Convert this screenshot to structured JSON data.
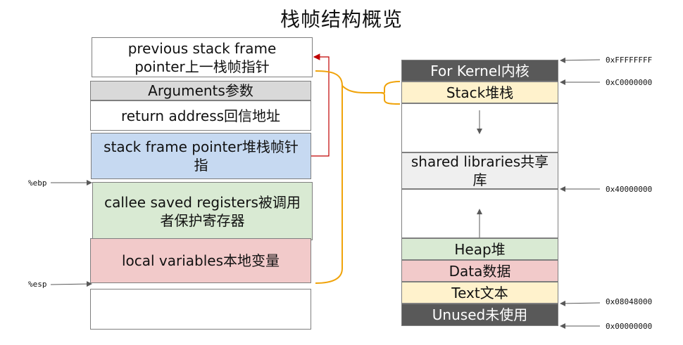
{
  "title": "栈帧结构概览",
  "left_stack": {
    "previous_frame": "previous stack frame pointer上一栈帧指针",
    "arguments": "Arguments参数",
    "return_address": "return address回信地址",
    "stack_frame_pointer": "stack frame pointer堆栈帧针指",
    "callee_saved": "callee saved registers被调用者保护寄存器",
    "local_variables": "local variables本地变量",
    "empty": ""
  },
  "registers": {
    "ebp": "%ebp",
    "esp": "%esp"
  },
  "memory_map": {
    "kernel": "For Kernel内核",
    "stack": "Stack堆栈",
    "shared_libs": "shared libraries共享库",
    "heap": "Heap堆",
    "data": "Data数据",
    "text": "Text文本",
    "unused": "Unused未使用"
  },
  "addresses": {
    "a_ffffffff": "0xFFFFFFFF",
    "a_c0000000": "0xC0000000",
    "a_40000000": "0x40000000",
    "a_08048000": "0x08048000",
    "a_00000000": "0x00000000"
  },
  "colors": {
    "arguments_bg": "#d9d9d9",
    "frame_pointer_bg": "#c6d9f1",
    "callee_bg": "#d9ead3",
    "locals_bg": "#f2caca",
    "kernel_bg": "#595959",
    "stack_bg": "#fff2cc",
    "shared_bg": "#efefef",
    "heap_bg": "#d9ead3",
    "data_bg": "#f2caca",
    "text_bg": "#fff2cc",
    "unused_bg": "#595959",
    "brace": "#f0a30a",
    "pointer_arrow": "#c00000"
  }
}
